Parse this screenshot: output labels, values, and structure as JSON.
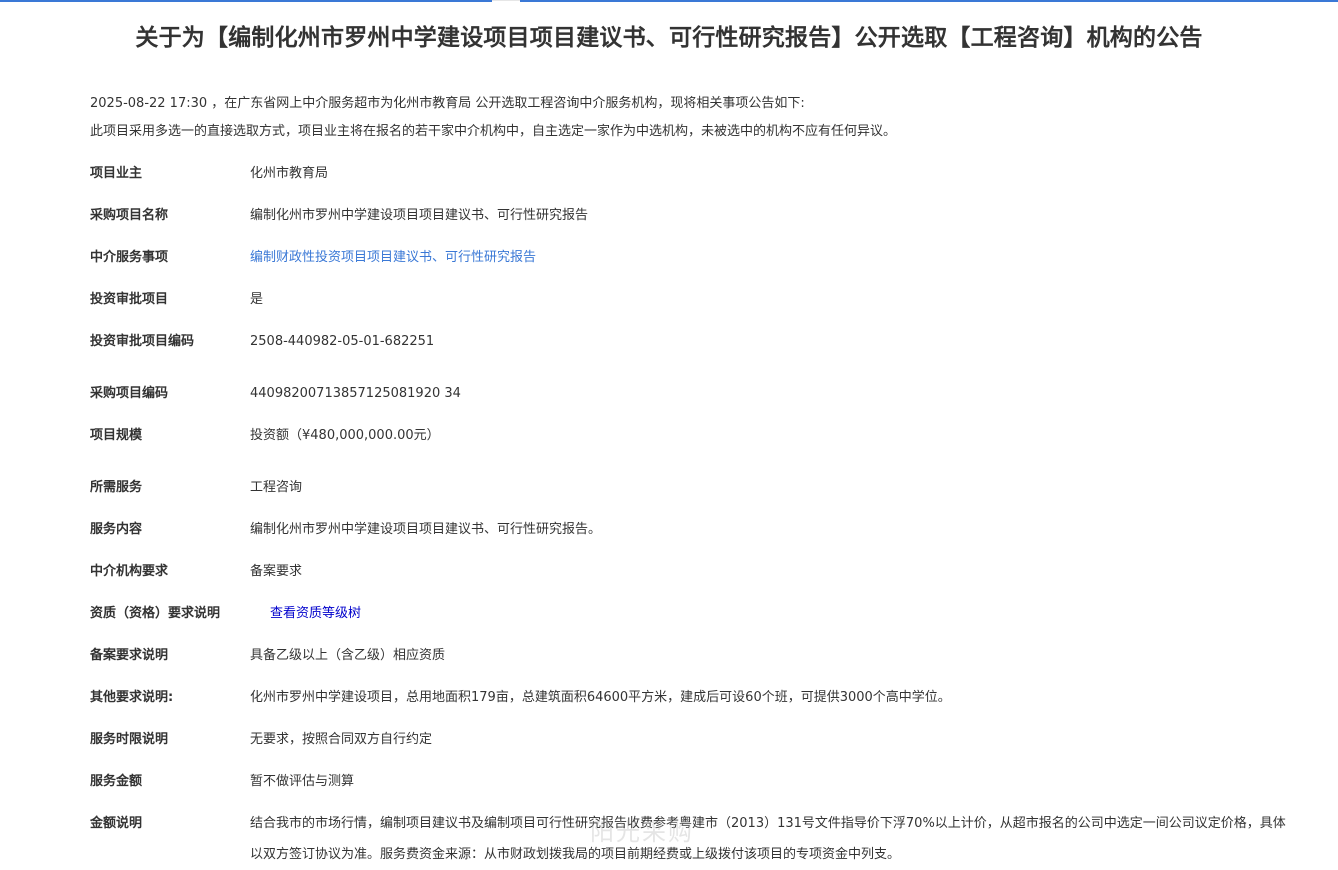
{
  "title": "关于为【编制化州市罗州中学建设项目项目建议书、可行性研究报告】公开选取【工程咨询】机构的公告",
  "intro": {
    "line1": "2025-08-22 17:30 ，在广东省网上中介服务超市为化州市教育局 公开选取工程咨询中介服务机构，现将相关事项公告如下:",
    "line2": "此项目采用多选一的直接选取方式，项目业主将在报名的若干家中介机构中，自主选定一家作为中选机构，未被选中的机构不应有任何异议。"
  },
  "fields": {
    "owner": {
      "label": "项目业主",
      "value": "化州市教育局"
    },
    "project_name": {
      "label": "采购项目名称",
      "value": "编制化州市罗州中学建设项目项目建议书、可行性研究报告"
    },
    "service_item": {
      "label": "中介服务事项",
      "value": "编制财政性投资项目项目建议书、可行性研究报告"
    },
    "approval": {
      "label": "投资审批项目",
      "value": "是"
    },
    "approval_code": {
      "label": "投资审批项目编码",
      "value": "2508-440982-05-01-682251"
    },
    "purchase_code": {
      "label": "采购项目编码",
      "value": "44098200713857125081920 34"
    },
    "scale": {
      "label": "项目规模",
      "value": "投资额（¥480,000,000.00元）"
    },
    "required_service": {
      "label": "所需服务",
      "value": "工程咨询"
    },
    "service_content": {
      "label": "服务内容",
      "value": "编制化州市罗州中学建设项目项目建议书、可行性研究报告。"
    },
    "agency_req": {
      "label": "中介机构要求",
      "value": "备案要求"
    },
    "qualification": {
      "label": "资质（资格）要求说明",
      "value": "查看资质等级树"
    },
    "filing_req": {
      "label": "备案要求说明",
      "value": "具备乙级以上（含乙级）相应资质"
    },
    "other_req": {
      "label": "其他要求说明:",
      "value": "化州市罗州中学建设项目，总用地面积179亩，总建筑面积64600平方米，建成后可设60个班，可提供3000个高中学位。"
    },
    "time_limit": {
      "label": "服务时限说明",
      "value": "无要求，按照合同双方自行约定"
    },
    "amount": {
      "label": "服务金额",
      "value": "暂不做评估与测算"
    },
    "amount_note": {
      "label": "金额说明",
      "value": "结合我市的市场行情，编制项目建议书及编制项目可行性研究报告收费参考粤建市（2013）131号文件指导价下浮70%以上计价，从超市报名的公司中选定一间公司议定价格，具体以双方签订协议为准。服务费资金来源：从市财政划拨我局的项目前期经费或上级拨付该项目的专项资金中列支。"
    }
  },
  "watermark": "阳光采购",
  "colors": {
    "link": "#3a78d6",
    "link_dark": "#0000cc",
    "accent": "#3a78d6"
  }
}
